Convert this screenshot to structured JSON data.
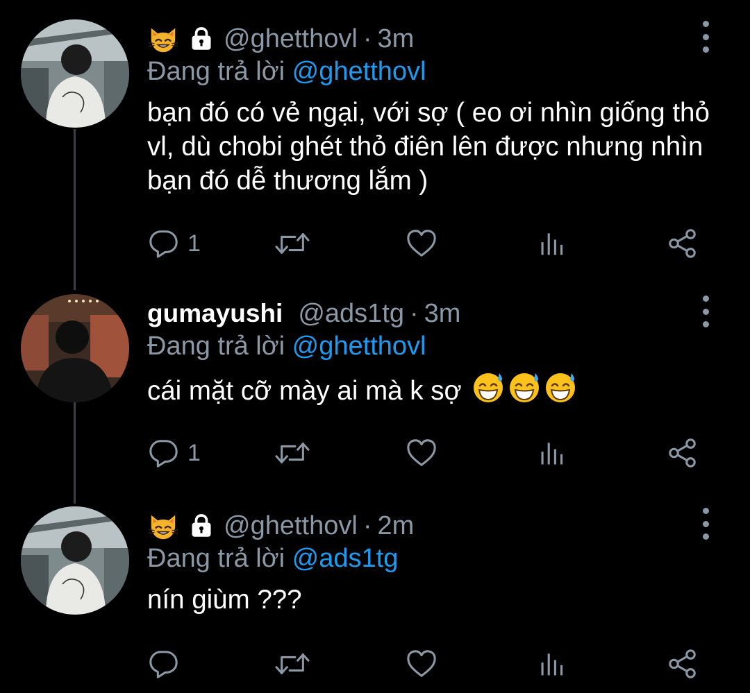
{
  "tweets": [
    {
      "name_emoji": "cat-grin-emoji",
      "locked": true,
      "display_name": "",
      "handle": "@ghetthovl",
      "separator": "·",
      "time": "3m",
      "reply_prefix": "Đang trả lời",
      "reply_to": "@ghetthovl",
      "text": "bạn đó có vẻ ngại, với sợ ( eo ơi nhìn giống thỏ vl, dù chobi ghét thỏ điên lên được nhưng nhìn bạn đó dễ thương lắm )",
      "emojis": [],
      "reply_count": "1"
    },
    {
      "display_name": "gumayushi",
      "handle": "@ads1tg",
      "separator": "·",
      "time": "3m",
      "reply_prefix": "Đang trả lời",
      "reply_to": "@ghetthovl",
      "text": "cái mặt cỡ mày ai mà k sợ",
      "emojis": [
        "grinning-sweat-emoji",
        "grinning-sweat-emoji",
        "grinning-sweat-emoji"
      ],
      "reply_count": "1"
    },
    {
      "name_emoji": "cat-grin-emoji",
      "locked": true,
      "display_name": "",
      "handle": "@ghetthovl",
      "separator": "·",
      "time": "2m",
      "reply_prefix": "Đang trả lời",
      "reply_to": "@ads1tg",
      "text": "nín giùm ???",
      "emojis": [],
      "reply_count": ""
    }
  ],
  "icons": {
    "reply": "reply-icon",
    "retweet": "retweet-icon",
    "like": "heart-icon",
    "views": "views-icon",
    "share": "share-icon",
    "more": "more-vertical-icon",
    "lock": "lock-icon"
  },
  "colors": {
    "background": "#000000",
    "text": "#ffffff",
    "muted": "#8b98a5",
    "link": "#1d9bf0",
    "thread_line": "#3a3f44"
  }
}
